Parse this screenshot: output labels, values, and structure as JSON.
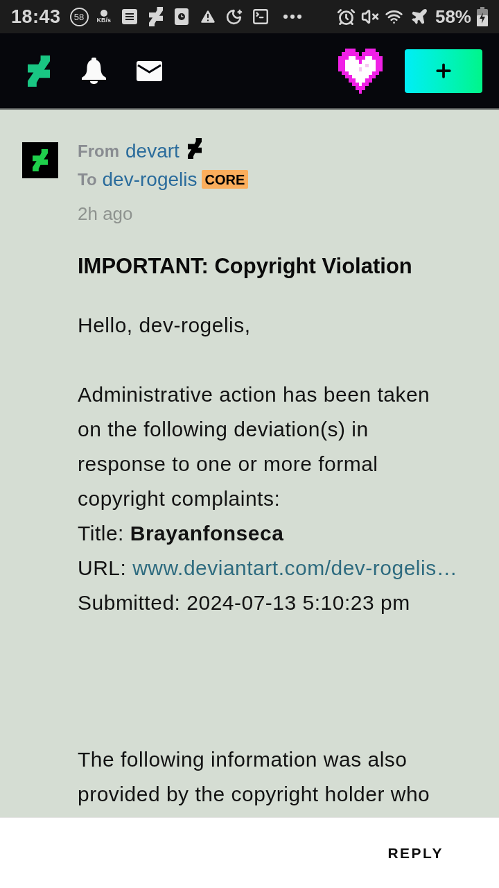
{
  "status_bar": {
    "time": "18:43",
    "data_badge": "58",
    "speed_unit": "KB/s",
    "battery": "58%"
  },
  "message": {
    "from_label": "From",
    "sender": "devart",
    "to_label": "To",
    "recipient": "dev-rogelis",
    "recipient_badge": "CORE",
    "time": "2h ago",
    "subject": "IMPORTANT: Copyright Violation",
    "greeting": "Hello, dev-rogelis,",
    "intro": "Administrative action has been taken on the following deviation(s) in response to one or more formal copyright complaints:",
    "fields": [
      {
        "kind": "bold",
        "label": "Title:",
        "value": "Brayanfonseca"
      },
      {
        "kind": "link",
        "label": "URL:",
        "value": "www.deviantart.com/dev-rogelis…"
      },
      {
        "kind": "text",
        "label": "Submitted:",
        "value": "2024-07-13 5:10:23 pm"
      }
    ],
    "closing": "The following information was also provided by the copyright holder who"
  },
  "footer": {
    "reply_button": "REPLY"
  }
}
